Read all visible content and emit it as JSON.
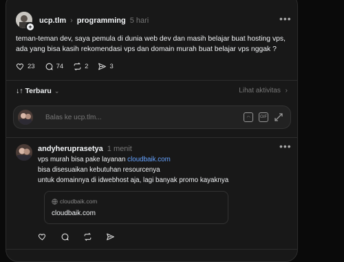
{
  "post": {
    "username": "ucp.tlm",
    "community": "programming",
    "time": "5 hari",
    "text_line1": "teman-teman dev, saya pemula di dunia web dev dan masih belajar buat hosting vps,",
    "text_line2": "ada yang bisa kasih rekomendasi vps dan domain murah buat belajar vps nggak ?",
    "likes": "23",
    "comments": "74",
    "reposts": "2",
    "shares": "3"
  },
  "sort": {
    "label": "Terbaru",
    "activity": "Lihat aktivitas"
  },
  "reply": {
    "placeholder": "Balas ke ucp.tlm..."
  },
  "comment": {
    "username": "andyheruprasetya",
    "time": "1 menit",
    "line1_prefix": "vps murah bisa pake layanan ",
    "line1_link": "cloudbaik.com",
    "line2": "bisa disesuaikan kebutuhan resourcenya",
    "line3": "untuk domainnya di idwebhost aja, lagi banyak promo kayaknya",
    "preview_domain": "cloudbaik.com",
    "preview_title": "cloudbaik.com"
  },
  "icons": [
    "heart-icon",
    "comment-icon",
    "repost-icon",
    "share-icon",
    "globe-icon",
    "more-icon",
    "gif-icon",
    "image-icon",
    "expand-icon"
  ]
}
